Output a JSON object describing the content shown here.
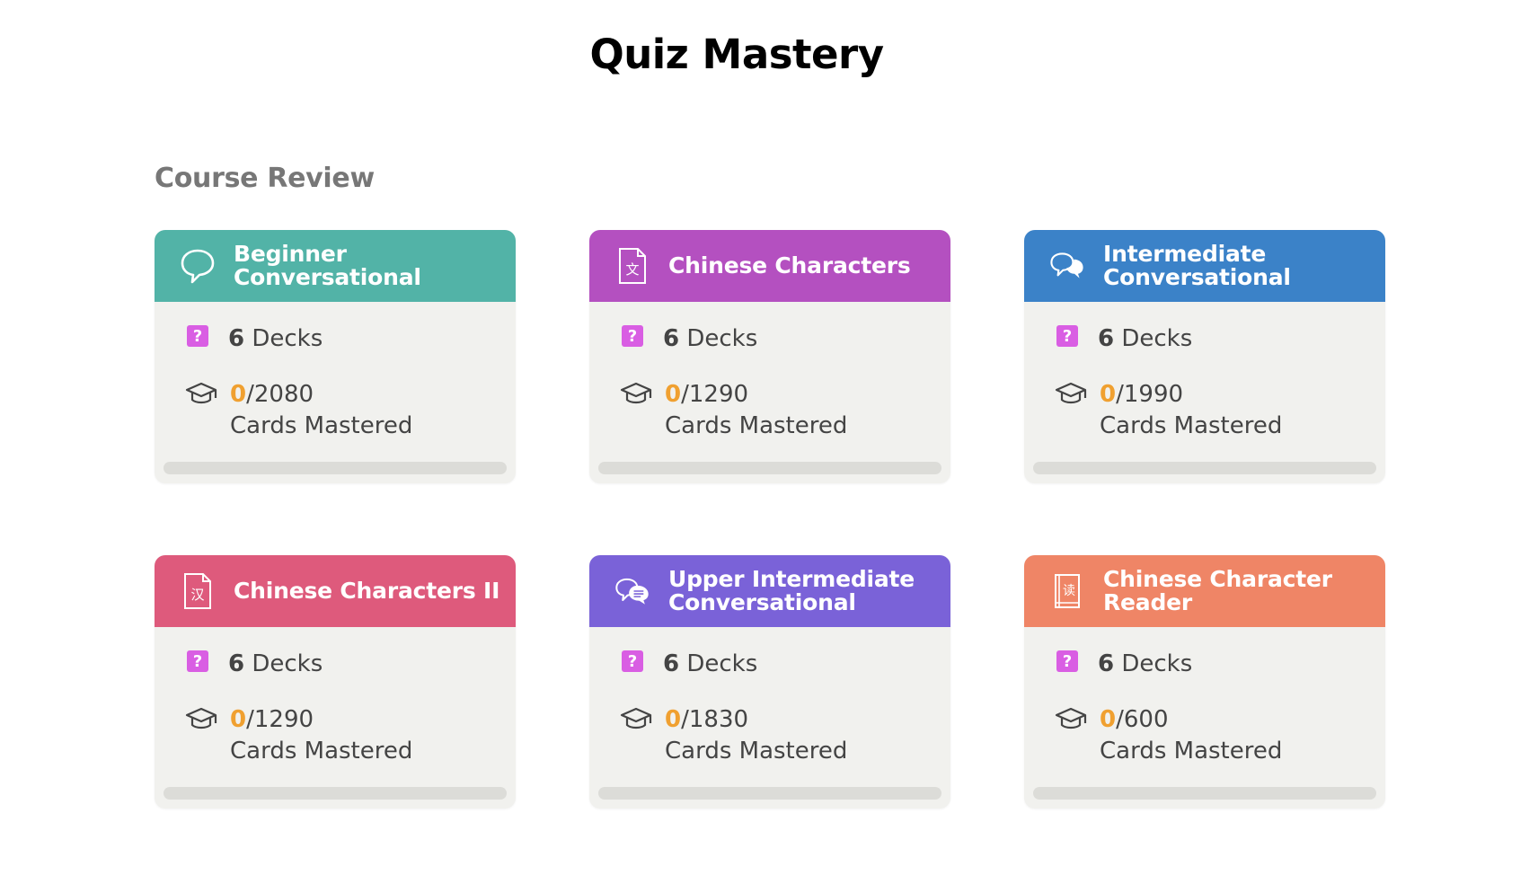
{
  "page": {
    "title": "Quiz Mastery"
  },
  "section": {
    "title": "Course Review"
  },
  "courses": [
    {
      "title": "Beginner Conversational",
      "icon": "speech-bubble-icon",
      "color": "#52b3a7",
      "decks_count": "6",
      "decks_label": "Decks",
      "mastered": "0",
      "total": "/2080",
      "mastered_label": "Cards Mastered",
      "progress": 0
    },
    {
      "title": "Chinese Characters",
      "icon": "document-character-icon",
      "color": "#b450c0",
      "decks_count": "6",
      "decks_label": "Decks",
      "mastered": "0",
      "total": "/1290",
      "mastered_label": "Cards Mastered",
      "progress": 0
    },
    {
      "title": "Intermediate Conversational",
      "icon": "double-speech-bubble-icon",
      "color": "#3b82c8",
      "decks_count": "6",
      "decks_label": "Decks",
      "mastered": "0",
      "total": "/1990",
      "mastered_label": "Cards Mastered",
      "progress": 0
    },
    {
      "title": "Chinese Characters II",
      "icon": "document-character-icon",
      "color": "#de5a7c",
      "decks_count": "6",
      "decks_label": "Decks",
      "mastered": "0",
      "total": "/1290",
      "mastered_label": "Cards Mastered",
      "progress": 0
    },
    {
      "title": "Upper Intermediate Conversational",
      "icon": "chat-bubbles-icon",
      "color": "#7a62d8",
      "decks_count": "6",
      "decks_label": "Decks",
      "mastered": "0",
      "total": "/1830",
      "mastered_label": "Cards Mastered",
      "progress": 0
    },
    {
      "title": "Chinese Character Reader",
      "icon": "book-character-icon",
      "color": "#ef8566",
      "decks_count": "6",
      "decks_label": "Decks",
      "mastered": "0",
      "total": "/600",
      "mastered_label": "Cards Mastered",
      "progress": 0
    }
  ],
  "icons": {
    "decks": "question-badge-icon",
    "mastered": "graduation-cap-icon",
    "doc_chars": [
      "文",
      "汉"
    ],
    "book_char": "读",
    "question_mark": "?"
  }
}
